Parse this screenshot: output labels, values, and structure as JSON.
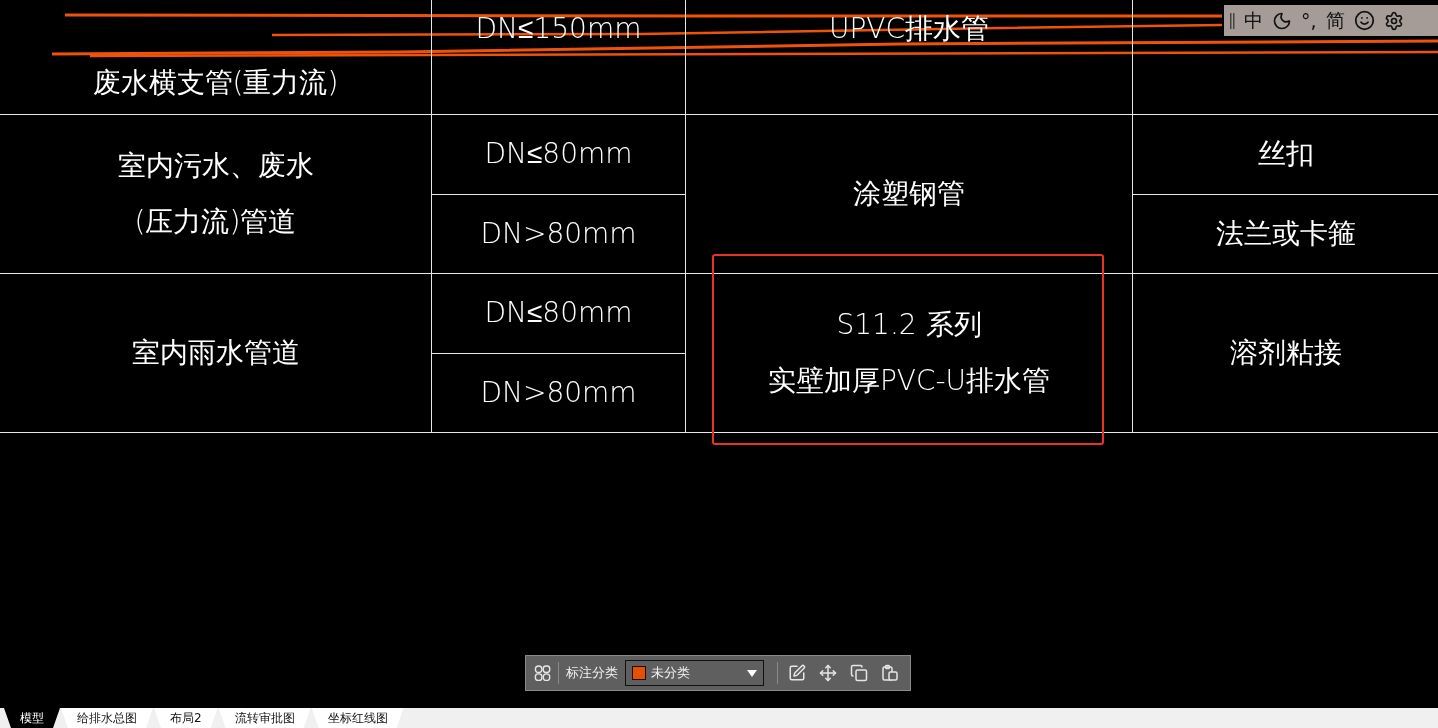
{
  "table": {
    "rows": [
      {
        "category": [
          "废水横支管(重力流)"
        ],
        "sizes": [
          "DN≤150mm"
        ],
        "material": [
          "UPVC排水管"
        ],
        "joints": [],
        "highlighted": false
      },
      {
        "category": [
          "室内污水、废水",
          "(压力流)管道"
        ],
        "sizes": [
          "DN≤80mm",
          "DN>80mm"
        ],
        "material": [
          "涂塑钢管"
        ],
        "joints": [
          "丝扣",
          "法兰或卡箍"
        ],
        "highlighted": false
      },
      {
        "category": [
          "室内雨水管道"
        ],
        "sizes": [
          "DN≤80mm",
          "DN>80mm"
        ],
        "material": [
          "S11.2 系列",
          "实壁加厚PVC-U排水管"
        ],
        "joints": [
          "溶剂粘接"
        ],
        "highlighted": true
      }
    ]
  },
  "ime_bar": {
    "items": [
      {
        "kind": "handle"
      },
      {
        "kind": "text",
        "label": "中"
      },
      {
        "kind": "moon"
      },
      {
        "kind": "text",
        "label": "°,"
      },
      {
        "kind": "text",
        "label": "简"
      },
      {
        "kind": "smile"
      },
      {
        "kind": "settings"
      }
    ]
  },
  "annotation_toolbar": {
    "label": "标注分类",
    "category": {
      "value": "未分类",
      "color": "#e65100"
    }
  },
  "layout_tabs": [
    {
      "label": "模型",
      "selected": true
    },
    {
      "label": "给排水总图",
      "selected": false
    },
    {
      "label": "布局2",
      "selected": false
    },
    {
      "label": "流转审批图",
      "selected": false
    },
    {
      "label": "坐标红线图",
      "selected": false
    }
  ]
}
